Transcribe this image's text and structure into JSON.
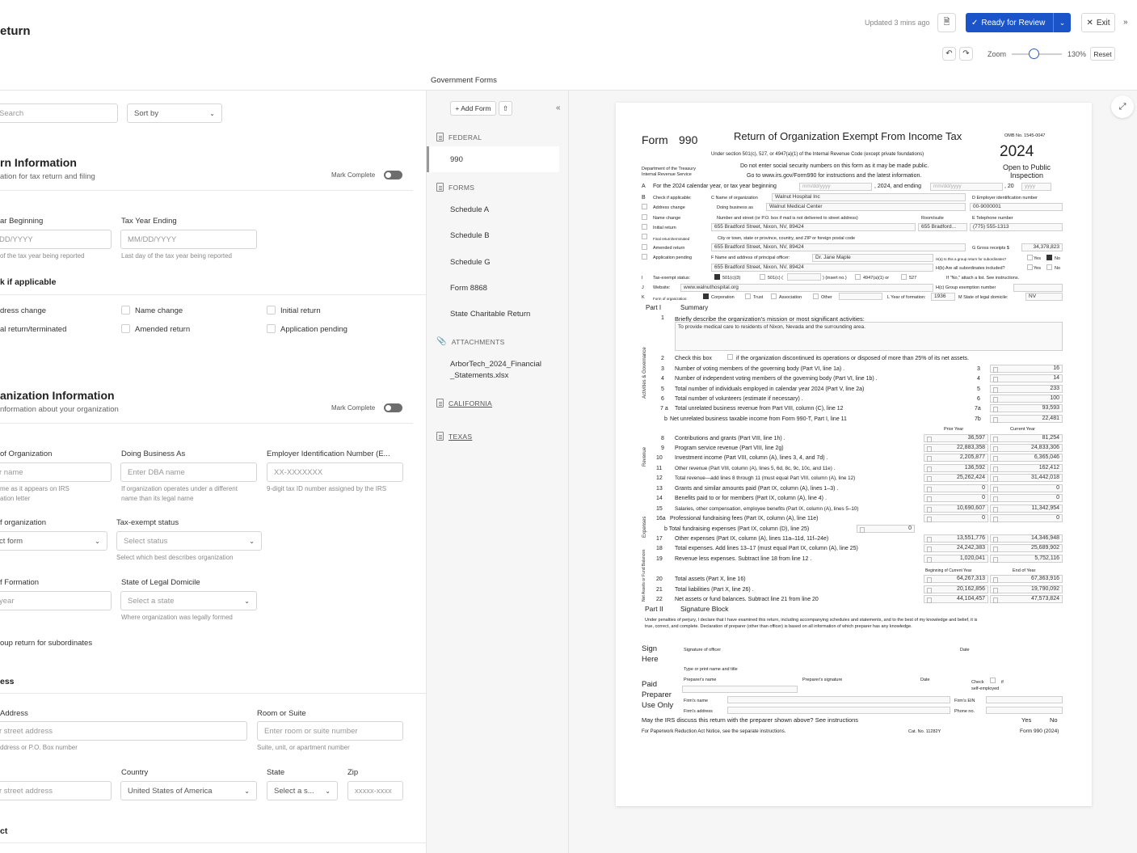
{
  "app": {
    "title": "eturn",
    "updated": "Updated 3 mins ago",
    "ready_label": "Ready for Review",
    "exit_label": "Exit",
    "zoom_label": "Zoom",
    "zoom_value": "130%",
    "zoom_level_fraction": 0.45,
    "reset_label": "Reset",
    "breadcrumb": "Government Forms",
    "accent_color": "#1a54c8"
  },
  "left": {
    "search_placeholder": "Search",
    "sort_label": "Sort by",
    "return_info": {
      "title": "rn Information",
      "subtitle": "ation for tax return and filing",
      "mark_complete": "Mark Complete",
      "tax_year_beginning_label": "ar Beginning",
      "tax_year_beginning_placeholder": "DD/YYYY",
      "tax_year_beginning_help": "of the tax year being reported",
      "tax_year_ending_label": "Tax Year Ending",
      "tax_year_ending_placeholder": "MM/DD/YYYY",
      "tax_year_ending_help": "Last day of the tax year being reported",
      "check_heading": "k if applicable",
      "checks": [
        "dress change",
        "Name change",
        "Initial return",
        "al return/terminated",
        "Amended return",
        "Application pending"
      ]
    },
    "org_info": {
      "title": "anization Information",
      "subtitle": "nformation about your organization",
      "mark_complete": "Mark Complete",
      "name_label": "of Organization",
      "name_placeholder": "r name",
      "name_help1": "me as it appears on IRS",
      "name_help2": "ation letter",
      "dba_label": "Doing Business As",
      "dba_placeholder": "Enter DBA name",
      "dba_help1": "If organization operates under a different",
      "dba_help2": "name than its legal name",
      "ein_label": "Employer Identification Number (E...",
      "ein_placeholder": "XX-XXXXXXX",
      "ein_help": "9-digit tax ID number assigned by the IRS",
      "form_org_label": "f organization",
      "form_org_value": "ct form",
      "tax_exempt_label": "Tax-exempt status",
      "tax_exempt_value": "Select status",
      "tax_exempt_help": "Select which best describes organization",
      "year_formation_label": "f Formation",
      "year_formation_placeholder": "year",
      "domicile_label": "State of Legal Domicile",
      "domicile_value": "Select a state",
      "domicile_help": "Where organization was legally formed",
      "group_return": "oup return for subordinates"
    },
    "address": {
      "heading": "ess",
      "street_label": "Address",
      "street_placeholder": "r street address",
      "street_help": "ddress or P.O. Box number",
      "room_label": "Room or Suite",
      "room_placeholder": "Enter room or suite number",
      "room_help": "Suite, unit, or apartment number",
      "street2_placeholder": "r street address",
      "country_label": "Country",
      "country_value": "United States of America",
      "state_label": "State",
      "state_value": "Select a s...",
      "zip_label": "Zip",
      "zip_placeholder": "xxxxx-xxxx"
    },
    "next_heading": "ct"
  },
  "nav": {
    "add_form": "+ Add Form",
    "federal": "FEDERAL",
    "federal_items": [
      "990"
    ],
    "forms": "FORMS",
    "forms_items": [
      "Schedule A",
      "Schedule B",
      "Schedule G",
      "Form 8868",
      "State Charitable Return"
    ],
    "attachments": "ATTACHMENTS",
    "attachment_line1": "ArborTech_2024_Financial",
    "attachment_line2": "_Statements.xlsx",
    "california": "CALIFORNIA",
    "texas": "TEXAS"
  },
  "form990": {
    "form_word": "Form",
    "form_number": "990",
    "title": "Return of Organization Exempt From Income Tax",
    "omb": "OMB No. 1545-0047",
    "year": "2024",
    "open_public1": "Open to Public",
    "open_public2": "Inspection",
    "under_section": "Under section 501(c), 527, or 4947(a)(1) of the Internal Revenue Code (except private foundations)",
    "do_not_enter": "Do not enter social security numbers on this form as it may be made public.",
    "goto": "Go to www.irs.gov/Form990 for instructions and the latest information.",
    "dept1": "Department of the Treasury",
    "dept2": "Internal Revenue Service",
    "line_a": "For the 2024 calendar year, or tax year beginning",
    "line_a_ph": "mm/dd/yyyy",
    "line_a_mid": ", 2024, and ending",
    "line_a_ph2": "mm/dd/yyyy",
    "line_a_end": ", 20",
    "line_a_ph3": "yyyy",
    "check_applicable": "Check if applicable:",
    "org_name_label": "C Name of organization",
    "org_name": "Walnut Hospital Inc",
    "ein_label": "D Employer identification number",
    "ein": "00-9000001",
    "address_change": "Address change",
    "dba_label": "Doing business as",
    "dba": "Walnut Medical Center",
    "name_change": "Name change",
    "street_label": "Number and street (or P.O. box if mail is not delivered to street address)",
    "room_label": "Room/suite",
    "phone_label": "E Telephone number",
    "initial_return": "Initial return",
    "street": "655 Bradford Street, Nixon, NV, 89424",
    "room": "655 Bradford...",
    "phone": "(775) 555-1313",
    "final_return": "Final return/terminated",
    "city_label": "City or town, state or province, country, and ZIP or foreign postal code",
    "amended_return": "Amended return",
    "city": "655 Bradford Street, Nixon, NV, 89424",
    "gross_label": "G Gross receipts $",
    "gross": "34,378,823",
    "app_pending": "Application pending",
    "principal_label": "F Name and address of principal officer:",
    "principal": "Dr. Jane Maple",
    "ha_label": "H(a) Is this a group return for subordinates?",
    "yes": "Yes",
    "no": "No",
    "principal_addr": "655 Bradford Street, Nixon, NV, 89424",
    "hb_label": "H(b) Are all subordinates included?",
    "hb_note": "If \"No,\" attach a list. See instructions.",
    "tax_exempt_label": "Tax-exempt status:",
    "s501c3": "501(c)(3)",
    "s501c": "501(c) (",
    "insert_no": ") (insert no.)",
    "s4947": "4947(a)(1)  or",
    "s527": "527",
    "website_label": "Website:",
    "website": "www.walnuthospital.org",
    "hc_label": "H(c) Group exemption number",
    "form_org_label": "Form of organization:",
    "corporation": "Corporation",
    "trust": "Trust",
    "association": "Association",
    "other": "Other",
    "year_formation_label": "L Year of formation:",
    "year_formation": "1936",
    "domicile_label": "M State of legal domicile:",
    "domicile": "NV",
    "part1": "Part I",
    "summary": "Summary",
    "line1": "Briefly describe the organization's mission or most significant activities:",
    "mission": "To provide medical care to residents of Nixon, Nevada and the surrounding area.",
    "activities_gov": "Activities & Governance",
    "line2": "Check this box",
    "line2b": "if the organization discontinued its operations or disposed of more than 25% of its net assets.",
    "gov_lines": [
      {
        "n": "3",
        "text": "Number of voting members of the governing body (Part VI, line 1a) .",
        "box": "3",
        "val": "16"
      },
      {
        "n": "4",
        "text": "Number of independent voting members of the governing body (Part VI, line 1b) .",
        "box": "4",
        "val": "14"
      },
      {
        "n": "5",
        "text": "Total number of individuals employed in calendar year 2024 (Part V, line 2a)",
        "box": "5",
        "val": "233"
      },
      {
        "n": "6",
        "text": "Total number of volunteers (estimate if necessary) .",
        "box": "6",
        "val": "100"
      },
      {
        "n": "7 a",
        "text": "Total unrelated business revenue from Part VIII, column (C), line 12",
        "box": "7a",
        "val": "93,593"
      },
      {
        "n": "b",
        "text": "Net unrelated business taxable income from Form 990-T, Part I, line 11",
        "box": "7b",
        "val": "22,481"
      }
    ],
    "prior_year": "Prior Year",
    "current_year": "Current Year",
    "revenue": "Revenue",
    "expenses": "Expenses",
    "rev_lines": [
      {
        "n": "8",
        "text": "Contributions and grants (Part VIII, line 1h) .",
        "prior": "36,597",
        "current": "81,254"
      },
      {
        "n": "9",
        "text": "Program service revenue (Part VIII, line 2g)",
        "prior": "22,883,358",
        "current": "24,833,306"
      },
      {
        "n": "10",
        "text": "Investment income (Part VIII, column (A), lines 3, 4, and 7d) .",
        "prior": "2,205,877",
        "current": "6,365,046"
      },
      {
        "n": "11",
        "text": "Other revenue (Part VIII, column (A), lines 5, 6d, 8c, 9c, 10c, and 11e) .",
        "prior": "136,592",
        "current": "162,412"
      },
      {
        "n": "12",
        "text": "Total revenue—add lines 8 through 11 (must equal Part VIII, column (A), line 12)",
        "prior": "25,262,424",
        "current": "31,442,018"
      },
      {
        "n": "13",
        "text": "Grants and similar amounts paid (Part IX, column (A), lines 1–3) .",
        "prior": "0",
        "current": "0"
      },
      {
        "n": "14",
        "text": "Benefits paid to or for members (Part IX, column (A), line 4) .",
        "prior": "0",
        "current": "0"
      },
      {
        "n": "15",
        "text": "Salaries, other compensation, employee benefits (Part IX, column (A), lines 5–10)",
        "prior": "10,690,607",
        "current": "11,342,954"
      },
      {
        "n": "16a",
        "text": "Professional fundraising fees (Part IX, column (A), line 11e)",
        "prior": "0",
        "current": "0"
      }
    ],
    "line16b": "b  Total fundraising expenses (Part IX, column (D), line 25)",
    "line16b_val": "0",
    "exp_lines": [
      {
        "n": "17",
        "text": "Other expenses (Part IX, column (A), lines 11a–11d, 11f–24e)",
        "prior": "13,551,776",
        "current": "14,346,948"
      },
      {
        "n": "18",
        "text": "Total expenses. Add lines 13–17 (must equal Part IX, column (A), line 25)",
        "prior": "24,242,383",
        "current": "25,689,902"
      },
      {
        "n": "19",
        "text": "Revenue less expenses. Subtract line 18 from line 12 .",
        "prior": "1,020,041",
        "current": "5,752,116"
      }
    ],
    "boy": "Beginning of Current Year",
    "eoy": "End of Year",
    "net_assets": "Net Assets or Fund Balances",
    "na_lines": [
      {
        "n": "20",
        "text": "Total assets (Part X, line 16)",
        "prior": "64,267,313",
        "current": "67,363,916"
      },
      {
        "n": "21",
        "text": "Total liabilities (Part X, line 26) .",
        "prior": "20,162,856",
        "current": "19,790,092"
      },
      {
        "n": "22",
        "text": "Net assets or fund balances. Subtract line 21 from line 20",
        "prior": "44,104,457",
        "current": "47,573,824"
      }
    ],
    "part2": "Part II",
    "sig_block": "Signature Block",
    "perjury1": "Under penalties of perjury, I declare that I have examined this return, including accompanying schedules and statements, and to the best of my knowledge and belief, it is",
    "perjury2": "true, correct, and complete. Declaration of preparer (other than officer) is based on all information of which preparer has any knowledge.",
    "sign1": "Sign",
    "sign2": "Here",
    "sig_officer": "Signature of officer",
    "date": "Date",
    "type_name": "Type or print name and title",
    "paid1": "Paid",
    "paid2": "Preparer",
    "paid3": "Use Only",
    "prep_name": "Preparer's name",
    "prep_sig": "Preparer's signature",
    "check_if": "Check",
    "if_word": "if",
    "self_emp": "self-employed",
    "firm_name": "Firm's name",
    "firm_ein": "Firm's EIN",
    "firm_addr": "Firm's address",
    "phone_no": "Phone no.",
    "irs_discuss": "May the IRS discuss this return with the preparer shown above? See instructions",
    "paperwork": "For Paperwork Reduction Act Notice, see the separate instructions.",
    "cat_no": "Cat. No. 11282Y",
    "form_footer": "Form 990 (2024)"
  }
}
